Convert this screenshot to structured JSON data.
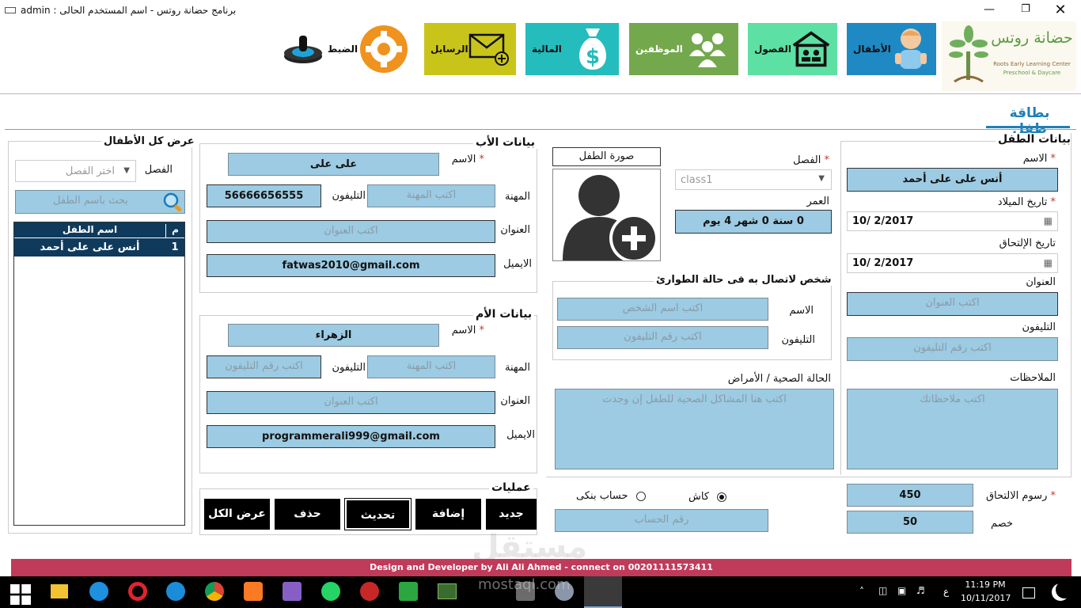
{
  "window": {
    "title": "برنامج حضانة روتس   -  اسم المستخدم الحالى  :  admin"
  },
  "nav": [
    {
      "label": "الضبط",
      "color": "#ffffff"
    },
    {
      "label": "الرسايل",
      "color": "#c9c41a"
    },
    {
      "label": "المالية",
      "color": "#24bcbc"
    },
    {
      "label": "الموظفين",
      "color": "#74a84c"
    },
    {
      "label": "الفصول",
      "color": "#5de0a3"
    },
    {
      "label": "الأطفال",
      "color": "#1f89c4"
    }
  ],
  "logo": {
    "name": "حضانة روتس",
    "sub1": "Roots Early Learning Center",
    "sub2": "Preschool & Daycare"
  },
  "page_title": "بطاقة طفل",
  "child": {
    "section": "بيانات الطفل",
    "name_label": "الاسم",
    "name_value": "أنس على على أحمد",
    "birth_label": "تاريخ الميلاد",
    "birth_value": "10/   2/2017",
    "join_label": "تاريخ الإلتحاق",
    "join_value": "10/   2/2017",
    "address_label": "العنوان",
    "address_ph": "اكتب العنوان",
    "phone_label": "التليفون",
    "phone_ph": "اكتب رقم التليفون",
    "notes_label": "الملاحظات",
    "notes_ph": "اكتب ملاحظاتك",
    "class_label": "الفصل",
    "class_value": "class1",
    "age_label": "العمر",
    "age_value": "0 سنة 0 شهر   4   يوم",
    "photo_label": "صورة الطفل",
    "health_label": "الحالة الصحية / الأمراض",
    "health_ph": "اكتب هنا المشاكل الصحية للطفل إن وجدت"
  },
  "emergency": {
    "title": "شخص لاتصال به فى حالة الطوارئ",
    "name_label": "الاسم",
    "name_ph": "اكتب اسم الشخص",
    "phone_label": "التليفون",
    "phone_ph": "اكتب رقم التليفون"
  },
  "fees": {
    "fee_label": "رسوم الالتحاق",
    "fee_value": "450",
    "discount_label": "خصم",
    "discount_value": "50",
    "cash_label": "كاش",
    "bank_label": "حساب بنكى",
    "account_ph": "رقم الحساب"
  },
  "father": {
    "section": "بيانات الأب",
    "name_label": "الاسم",
    "name_value": "على على",
    "job_label": "المهنة",
    "job_ph": "اكتب المهنة",
    "phone_label": "التليفون",
    "phone_value": "56666656555",
    "address_label": "العنوان",
    "address_ph": "اكتب العنوان",
    "email_label": "الايميل",
    "email_value": "fatwas2010@gmail.com"
  },
  "mother": {
    "section": "بيانات الأم",
    "name_label": "الاسم",
    "name_value": "الزهراء",
    "job_label": "المهنة",
    "job_ph": "اكتب المهنة",
    "phone_label": "التليفون",
    "phone_ph": "اكتب رقم التليفون",
    "address_label": "العنوان",
    "address_ph": "اكتب العنوان",
    "email_label": "الايميل",
    "email_value": "programmerali999@gmail.com"
  },
  "ops": {
    "title": "عمليات",
    "buttons": [
      "جديد",
      "إضافة",
      "تحديث",
      "حذف",
      "عرض الكل"
    ]
  },
  "list": {
    "title": "عرض كل الأطفال",
    "class_label": "الفصل",
    "class_ph": "اختر الفصل",
    "search_ph": "بحث باسم الطفل",
    "col_num": "م",
    "col_name": "اسم الطفل",
    "rows": [
      {
        "num": "1",
        "name": "أنس على على أحمد"
      }
    ]
  },
  "footer": "Design and Developer by Ali Ali Ahmed - connect on 00201111573411",
  "watermark": {
    "brand": "مستقل",
    "url": "mostaql.com"
  },
  "taskbar": {
    "time": "11:19 PM",
    "date": "10/11/2017",
    "lang": "ع"
  }
}
